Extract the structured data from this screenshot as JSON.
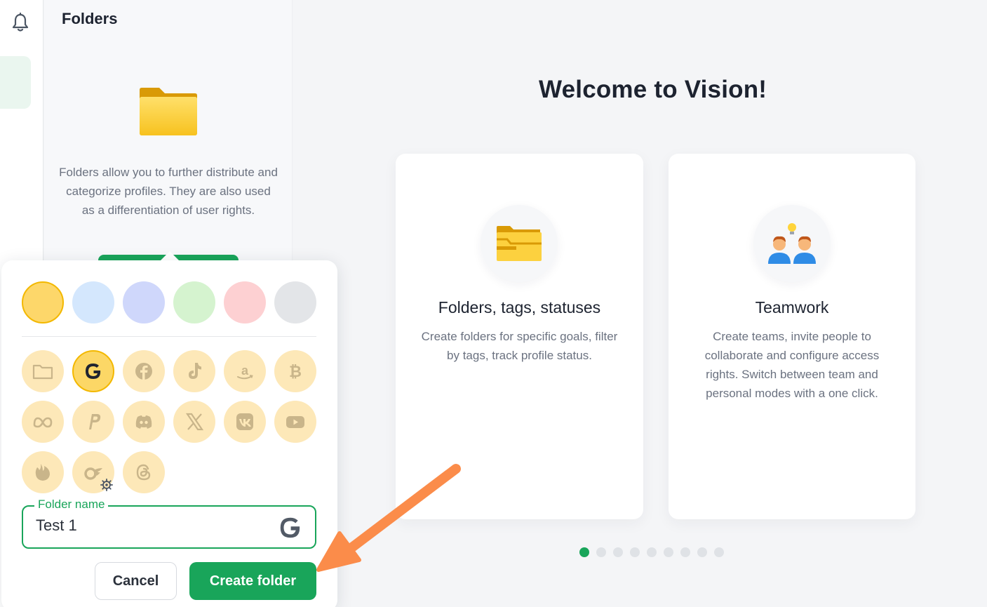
{
  "sidebar": {
    "notification_icon": "bell-icon"
  },
  "folders_panel": {
    "title": "Folders",
    "description": "Folders allow you to further distribute and categorize profiles. They are also used as a differentiation of user rights."
  },
  "welcome": {
    "title": "Welcome to Vision!",
    "cards": [
      {
        "title": "Folders, tags, statuses",
        "description": "Create folders for specific goals, filter by tags, track profile status.",
        "icon": "folders-icon"
      },
      {
        "title": "Teamwork",
        "description": "Create teams, invite people to collaborate and configure access rights. Switch between team and personal modes with a one click.",
        "icon": "team-icon"
      }
    ],
    "carousel": {
      "total": 9,
      "active": 1
    }
  },
  "create_folder_popup": {
    "colors": [
      "#fdd76a",
      "#d4e7fd",
      "#cfd7fb",
      "#d5f3cf",
      "#fdd0d2",
      "#e3e5e8"
    ],
    "selected_color": "#fdd76a",
    "icons": [
      "folder",
      "google",
      "facebook",
      "tiktok",
      "amazon",
      "bitcoin",
      "meta",
      "paypal",
      "discord",
      "x",
      "vk",
      "youtube",
      "tinder",
      "onlyfans",
      "threads"
    ],
    "selected_icon": "google",
    "folder_name_label": "Folder name",
    "folder_name_value": "Test 1",
    "cancel_label": "Cancel",
    "create_label": "Create folder"
  },
  "colors": {
    "accent": "#19a55a",
    "annotation_arrow": "#fb8c4a"
  }
}
